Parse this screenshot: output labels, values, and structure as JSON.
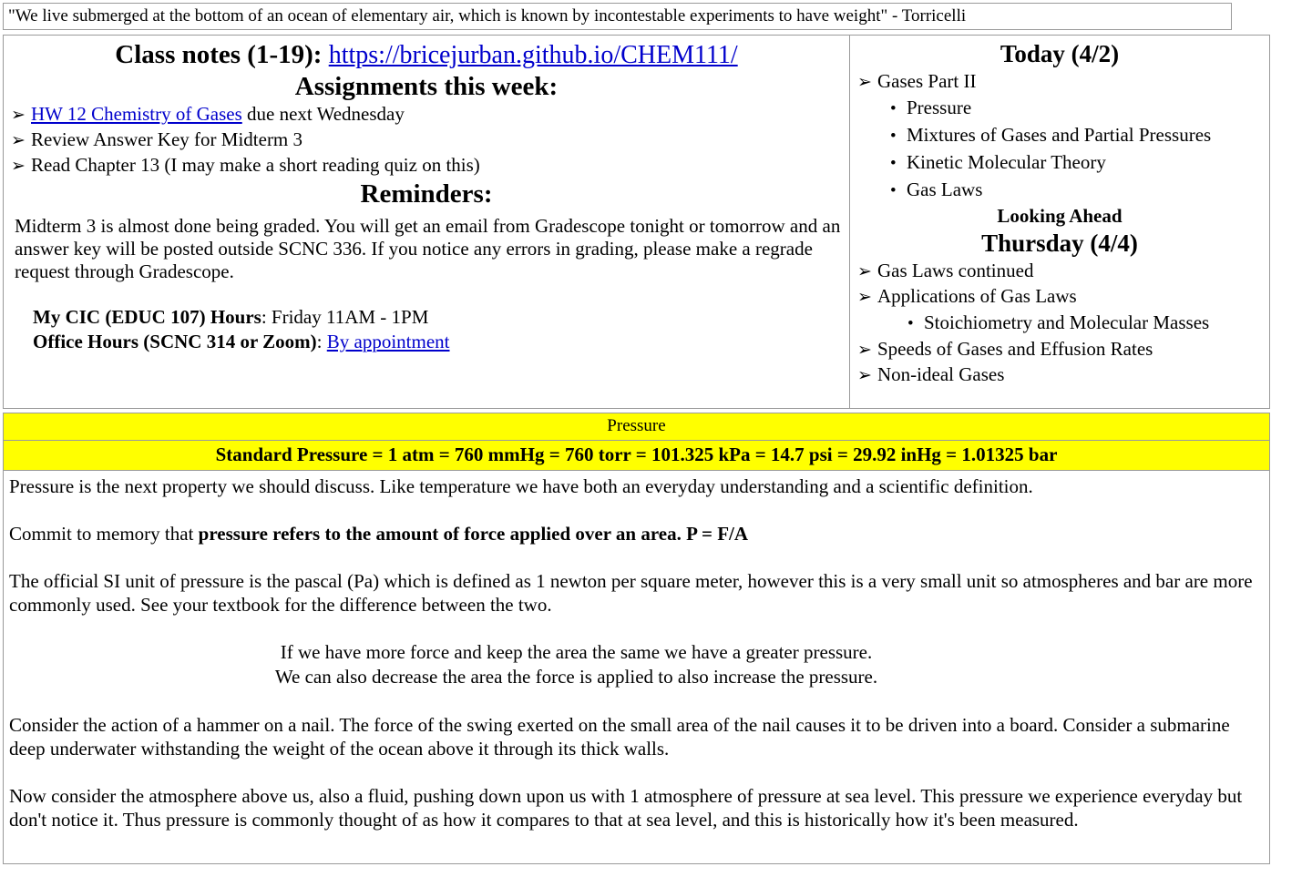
{
  "quote": {
    "text": "\"We live submerged at the bottom of an ocean of elementary air, which is known by incontestable experiments to have weight\" - Torricelli"
  },
  "left_panel": {
    "class_notes_label": "Class notes (1-19):",
    "class_notes_url": "https://bricejurban.github.io/CHEM111/",
    "assignments_heading": "Assignments this week:",
    "assignments": [
      {
        "bullet": "➢",
        "link": "HW 12 Chemistry of Gases",
        "text": " due next Wednesday"
      },
      {
        "bullet": "➢",
        "link": "",
        "text": "Review Answer Key for Midterm 3"
      },
      {
        "bullet": "➢",
        "link": "",
        "text": "Read Chapter 13 (I may make a short reading quiz on this)"
      }
    ],
    "reminders_heading": "Reminders:",
    "reminders_text": "Midterm 3 is almost done being graded. You will get an email from Gradescope tonight or tomorrow and an answer key will be posted outside SCNC 336. If you notice any errors in grading, please make a regrade request through Gradescope.",
    "cic_label": "My CIC (EDUC 107) Hours",
    "cic_value": ": Friday 11AM - 1PM",
    "office_label": "Office Hours (SCNC 314 or Zoom)",
    "office_sep": ": ",
    "office_link": "By appointment"
  },
  "right_panel": {
    "today_heading": "Today (4/2)",
    "today_items": [
      {
        "type": "arrow",
        "bullet": "➢",
        "text": "Gases Part II"
      },
      {
        "type": "dot",
        "bullet": "•",
        "text": "Pressure"
      },
      {
        "type": "dot",
        "bullet": "•",
        "text": "Mixtures of Gases and Partial Pressures"
      },
      {
        "type": "dot",
        "bullet": "•",
        "text": "Kinetic Molecular Theory"
      },
      {
        "type": "dot",
        "bullet": "•",
        "text": "Gas Laws"
      }
    ],
    "looking_ahead_heading": "Looking Ahead",
    "thursday_heading": "Thursday (4/4)",
    "thursday_items": [
      {
        "type": "arrow",
        "bullet": "➢",
        "text": "Gas Laws continued"
      },
      {
        "type": "arrow",
        "bullet": "➢",
        "text": "Applications of Gas Laws"
      },
      {
        "type": "dot",
        "bullet": "•",
        "text": "Stoichiometry and Molecular Masses"
      },
      {
        "type": "arrow",
        "bullet": "➢",
        "text": "Speeds of Gases and Effusion Rates"
      },
      {
        "type": "arrow",
        "bullet": "➢",
        "text": "Non-ideal Gases"
      }
    ]
  },
  "section": {
    "title": "Pressure",
    "subtitle": "Standard Pressure = 1 atm = 760 mmHg = 760 torr = 101.325 kPa = 14.7 psi = 29.92 inHg = 1.01325 bar",
    "background_color": "#ffff00"
  },
  "notes": {
    "p1": "Pressure is the next property we should discuss. Like temperature we have both an everyday understanding and a scientific definition.",
    "p2_lead": "Commit to memory that ",
    "p2_bold": "pressure refers to the amount of force applied over an area. P = F/A",
    "p3": "The official SI unit of pressure is the pascal (Pa) which is defined as 1 newton per square meter, however this is a very small unit so atmospheres and bar are more commonly used. See your textbook for the difference between the two.",
    "center1": "If we have more force and keep the area the same we have a greater pressure.",
    "center2": "We can also decrease the area the force is applied to also increase the pressure.",
    "p4": "Consider the action of a hammer on a nail. The force of the swing exerted on the small area of the nail causes it to be driven into a board. Consider a submarine deep underwater withstanding the weight of the ocean above it through its thick walls.",
    "p5": "Now consider the atmosphere above us, also a fluid, pushing down upon us with 1 atmosphere of pressure at sea level. This pressure we experience everyday but don't notice it. Thus pressure is commonly thought of as how it compares to that at sea level, and this is historically how it's been measured."
  }
}
